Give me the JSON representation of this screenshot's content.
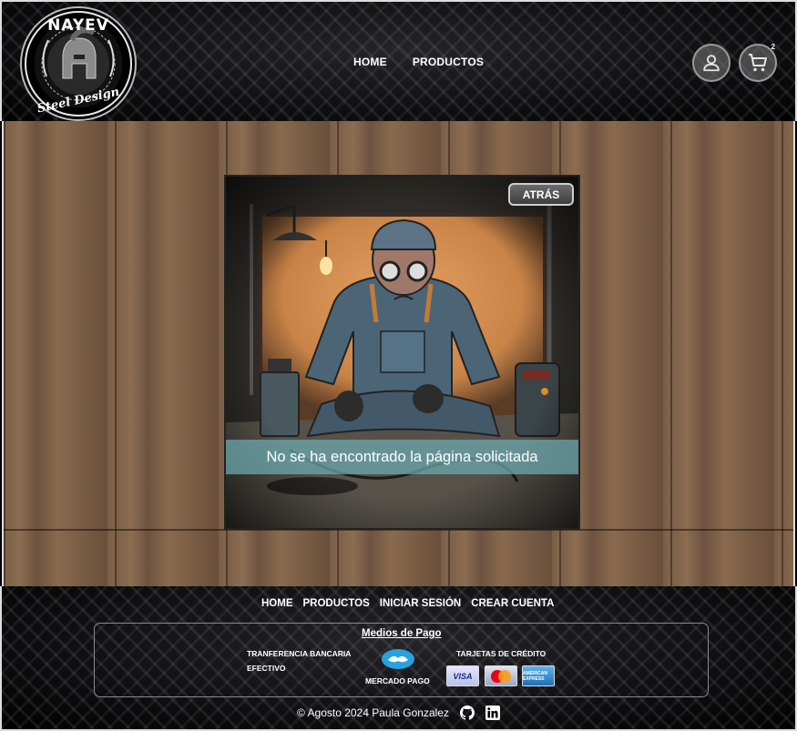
{
  "header": {
    "logo": {
      "title": "NAYEV",
      "subtitle": "Steel Design"
    },
    "nav": [
      {
        "label": "HOME"
      },
      {
        "label": "PRODUCTOS"
      }
    ],
    "user_icon": "user-icon",
    "cart_icon": "cart-icon",
    "cart_count": "2"
  },
  "main": {
    "back_label": "ATRÁS",
    "message": "No se ha encontrado la página solicitada"
  },
  "footer": {
    "nav": [
      {
        "label": "HOME"
      },
      {
        "label": "PRODUCTOS"
      },
      {
        "label": "INICIAR SESIÓN"
      },
      {
        "label": "CREAR CUENTA"
      }
    ],
    "payment": {
      "title": "Medios de Pago",
      "transfer": "TRANFERENCIA BANCARIA",
      "cash": "EFECTIVO",
      "mercadopago": "MERCADO PAGO",
      "cards": "TARJETAS DE CRÉDITO",
      "visa": "VISA",
      "amex": "AMERICAN EXPRESS"
    },
    "copyright": "© Agosto 2024 Paula Gonzalez",
    "social_icons": [
      "github-icon",
      "linkedin-icon"
    ]
  },
  "colors": {
    "banner": "#6eaab2",
    "wall": "#d88e4e",
    "overall": "#4b6577"
  }
}
